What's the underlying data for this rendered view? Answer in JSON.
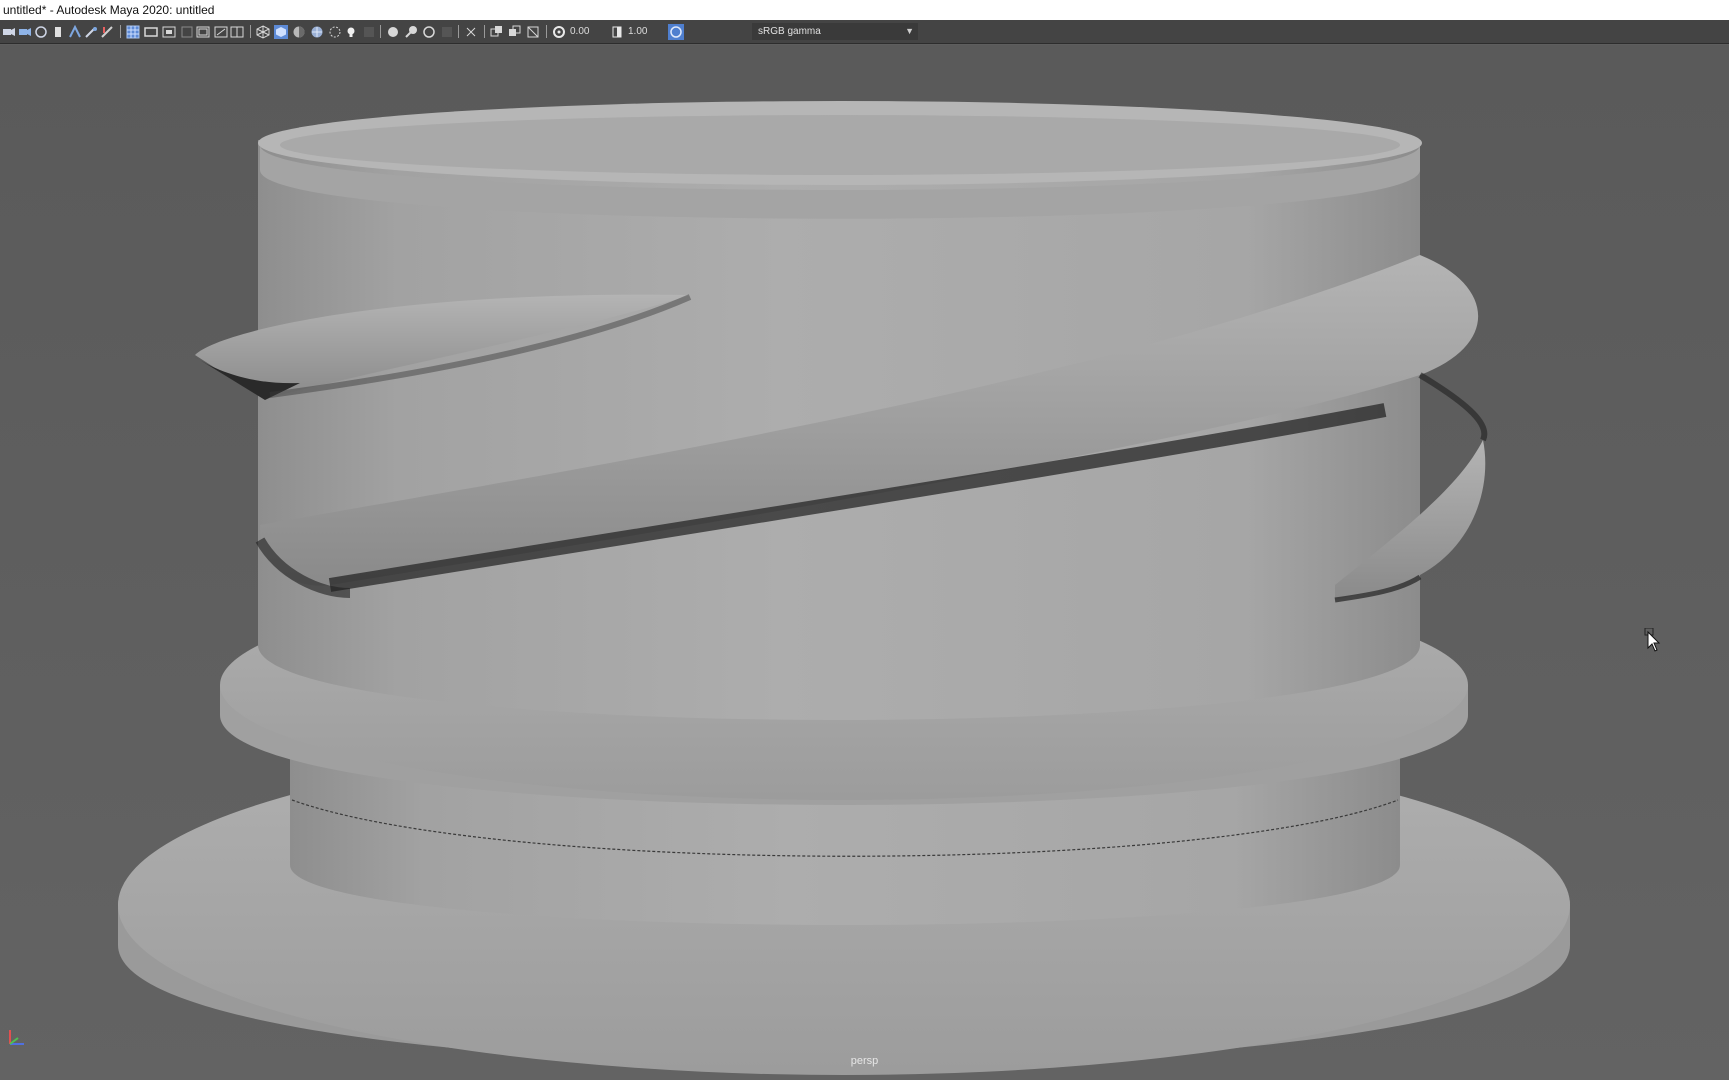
{
  "window": {
    "title": "untitled* - Autodesk Maya 2020: untitled"
  },
  "toolbar": {
    "exposure_value": "0.00",
    "gamma_value": "1.00",
    "color_space": "sRGB gamma",
    "icons": [
      "select-camera-icon",
      "camera-attributes-icon",
      "bookmarks-icon",
      "image-plane-icon",
      "2d-pan-zoom-icon",
      "grease-pencil-icon",
      "grid-icon",
      "film-gate-icon",
      "resolution-gate-icon",
      "gate-mask-icon",
      "field-chart-icon",
      "safe-action-icon",
      "safe-title-icon",
      "wireframe-icon",
      "smooth-shade-icon",
      "default-material-icon",
      "textured-icon",
      "lights-icon",
      "shadows-icon",
      "screen-space-ao-icon",
      "motion-blur-icon",
      "anti-aliasing-icon",
      "depth-of-field-icon",
      "isolate-select-icon",
      "xray-icon",
      "xray-joints-icon",
      "xray-components-icon",
      "exposure-icon",
      "gamma-icon",
      "color-management-icon"
    ]
  },
  "viewport": {
    "camera": "persp",
    "background_color": "#5e5e5e",
    "model_color": "#a8a8a8"
  }
}
